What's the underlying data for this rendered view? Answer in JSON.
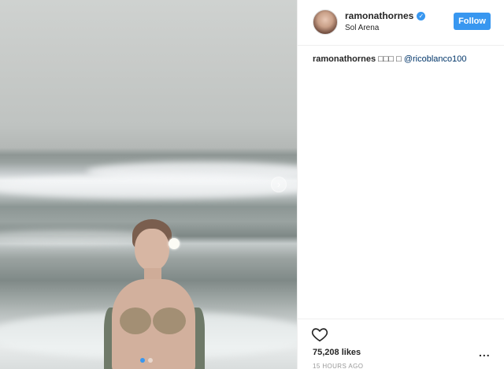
{
  "post": {
    "username": "ramonathornes",
    "verified_icon": "verified-badge-icon",
    "location": "Sol Arena",
    "follow_label": "Follow",
    "caption": {
      "username": "ramonathornes",
      "text": "□□□ □",
      "mention": "@ricoblanco100"
    },
    "likes": "75,208 likes",
    "timestamp": "15 HOURS AGO",
    "more_label": "...",
    "next_arrow": "›",
    "carousel": {
      "total": 2,
      "active_index": 1
    },
    "colors": {
      "accent": "#3897f0",
      "mention": "#003569",
      "text": "#262626",
      "muted": "#999999"
    }
  }
}
